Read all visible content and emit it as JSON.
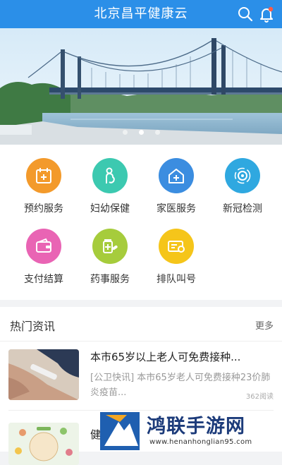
{
  "header": {
    "title": "北京昌平健康云",
    "icons": {
      "search": "search-icon",
      "notifications": "bell-icon"
    },
    "color": "#2b8fe8"
  },
  "banner": {
    "dots": 3,
    "active_dot": 1
  },
  "services": [
    {
      "label": "预约服务",
      "icon": "calendar-plus-icon",
      "color": "#f39a2b"
    },
    {
      "label": "妇幼保健",
      "icon": "mother-baby-icon",
      "color": "#3cc9b0"
    },
    {
      "label": "家医服务",
      "icon": "home-doctor-icon",
      "color": "#3b8de0"
    },
    {
      "label": "新冠检测",
      "icon": "virus-scan-icon",
      "color": "#2fa8e0"
    },
    {
      "label": "支付结算",
      "icon": "wallet-icon",
      "color": "#e964b4"
    },
    {
      "label": "药事服务",
      "icon": "medicine-icon",
      "color": "#a6cc3c"
    },
    {
      "label": "排队叫号",
      "icon": "ticket-icon",
      "color": "#f5c51a"
    }
  ],
  "news": {
    "title": "热门资讯",
    "more": "更多",
    "items": [
      {
        "headline": "本市65岁以上老人可免费接种...",
        "desc": "[公卫快讯] 本市65岁老人可免费接种23价肺炎疫苗...",
        "views": "362阅读"
      },
      {
        "headline": "健康"
      }
    ]
  },
  "watermark": {
    "text": "鸿联手游网",
    "url": "www.henanhonglian95.com"
  }
}
